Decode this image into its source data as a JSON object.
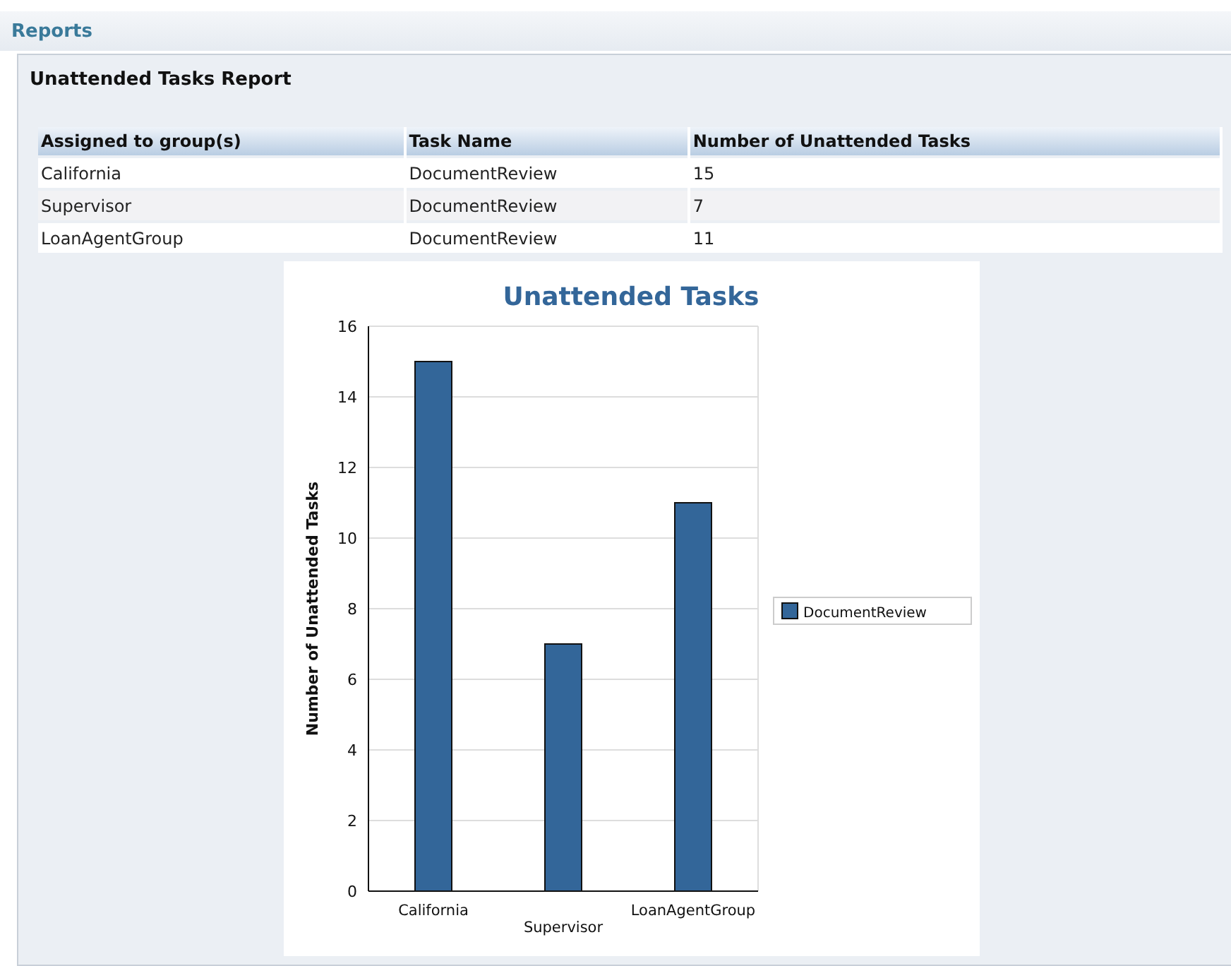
{
  "header": {
    "title": "Reports"
  },
  "report": {
    "title": "Unattended Tasks Report",
    "table": {
      "columns": [
        "Assigned to group(s)",
        "Task Name",
        "Number of Unattended Tasks"
      ],
      "rows": [
        [
          "California",
          "DocumentReview",
          "15"
        ],
        [
          "Supervisor",
          "DocumentReview",
          "7"
        ],
        [
          "LoanAgentGroup",
          "DocumentReview",
          "11"
        ]
      ]
    },
    "chart_data": {
      "type": "bar",
      "title": "Unattended Tasks",
      "ylabel": "Number of Unattended Tasks",
      "categories": [
        "California",
        "Supervisor",
        "LoanAgentGroup"
      ],
      "series": [
        {
          "name": "DocumentReview",
          "color": "#336699",
          "values": [
            15,
            7,
            11
          ]
        }
      ],
      "grid": true,
      "ylim": [
        0,
        16
      ],
      "yticks": [
        0,
        2,
        4,
        6,
        8,
        10,
        12,
        14,
        16
      ]
    }
  }
}
